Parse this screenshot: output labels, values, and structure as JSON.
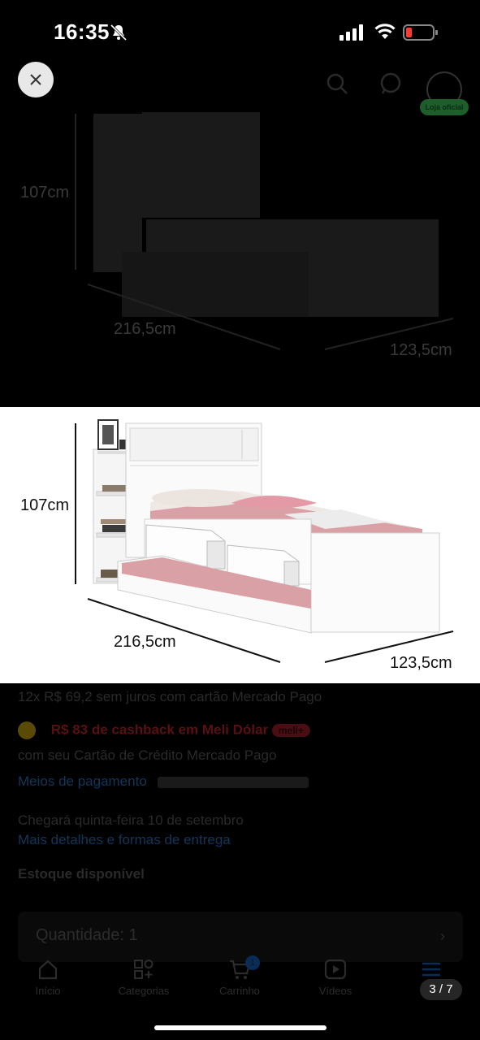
{
  "status_bar": {
    "time": "16:35"
  },
  "viewer": {
    "page_counter": "3 / 7"
  },
  "product_image": {
    "height_label": "107cm",
    "length_label": "216,5cm",
    "width_label": "123,5cm"
  },
  "background": {
    "installments": "12x R$ 69,2 sem juros com cartão Mercado Pago",
    "cashback": "R$ 83 de cashback em Meli Dólar",
    "meli_badge": "meli+",
    "card_note": "com seu Cartão de Crédito Mercado Pago",
    "payment_link": "Meios de pagamento",
    "arrival": "Chegará quinta-feira 10 de setembro",
    "delivery_link": "Mais detalhes e formas de entrega",
    "stock": "Estoque disponível",
    "quantity": "Quantidade: 1",
    "nav": [
      "Início",
      "Categorias",
      "Carrinho",
      "Vídeos"
    ],
    "cart_count": "1",
    "badge": "Loja oficial"
  },
  "colors": {
    "overlay": "#000000",
    "image_bg": "#ffffff",
    "pink_bedding": "#d9a0a6"
  }
}
